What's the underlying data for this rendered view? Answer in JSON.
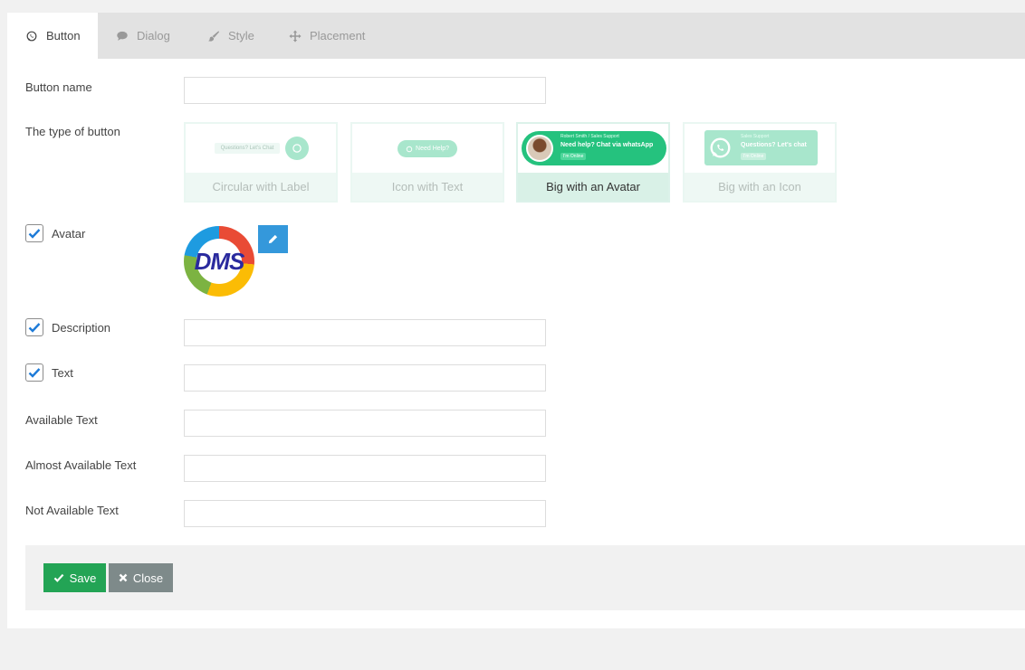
{
  "tabs": [
    {
      "label": "Button",
      "icon": "whatsapp-icon"
    },
    {
      "label": "Dialog",
      "icon": "chat-bubble-icon"
    },
    {
      "label": "Style",
      "icon": "brush-icon"
    },
    {
      "label": "Placement",
      "icon": "move-arrows-icon"
    }
  ],
  "form": {
    "button_name_label": "Button name",
    "button_name_value": "",
    "type_label": "The type of button",
    "avatar_label": "Avatar",
    "description_label": "Description",
    "description_value": "",
    "text_label": "Text",
    "text_value": "",
    "available_label": "Available Text",
    "available_value": "",
    "almost_label": "Almost Available Text",
    "almost_value": "",
    "not_available_label": "Not Available Text",
    "not_available_value": ""
  },
  "checkboxes": {
    "avatar": true,
    "description": true,
    "text": true
  },
  "button_types": [
    {
      "label": "Circular with Label",
      "preview_text": "Questions? Let's Chat",
      "selected": false
    },
    {
      "label": "Icon with Text",
      "preview_text": "Need Help?",
      "selected": false
    },
    {
      "label": "Big with an Avatar",
      "preview_name": "Robert Smith / Sales Support",
      "preview_title": "Need help? Chat via whatsApp",
      "preview_badge": "I'm Online",
      "selected": true
    },
    {
      "label": "Big with an Icon",
      "preview_name": "Sales Support",
      "preview_title": "Questions? Let's chat",
      "preview_badge": "I'm Online",
      "selected": false
    }
  ],
  "avatar_logo_text": "DMS",
  "actions": {
    "save": "Save",
    "close": "Close"
  },
  "colors": {
    "whatsapp_green": "#25c27e",
    "save_green": "#23a455",
    "close_gray": "#7e8a8a",
    "edit_blue": "#3498db"
  }
}
